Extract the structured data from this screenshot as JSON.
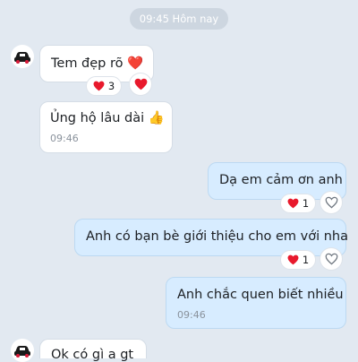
{
  "chat": {
    "date_divider": "09:45 Hôm nay",
    "messages": [
      {
        "sender": "contact",
        "text": "Tem đẹp rõ ❤️",
        "reaction": {
          "icon": "heart",
          "count": "3"
        },
        "react_button_icon": "heart"
      },
      {
        "sender": "contact",
        "text": "Ủng hộ lâu dài 👍",
        "time": "09:46"
      },
      {
        "sender": "me",
        "text": "Dạ em cảm ơn anh",
        "reaction": {
          "icon": "heart",
          "count": "1"
        },
        "react_button_icon": "heart-outline"
      },
      {
        "sender": "me",
        "text": "Anh có bạn bè giới thiệu cho em với nha",
        "reaction": {
          "icon": "heart",
          "count": "1"
        },
        "react_button_icon": "heart-outline"
      },
      {
        "sender": "me",
        "text": "Anh chắc quen biết nhiều",
        "time": "09:46"
      },
      {
        "sender": "contact",
        "text": "Ok có gì a gt"
      }
    ]
  },
  "colors": {
    "background": "#e2e9f1",
    "sent_bubble": "#d7ecff",
    "received_bubble": "#ffffff",
    "heart": "#e8192c"
  }
}
